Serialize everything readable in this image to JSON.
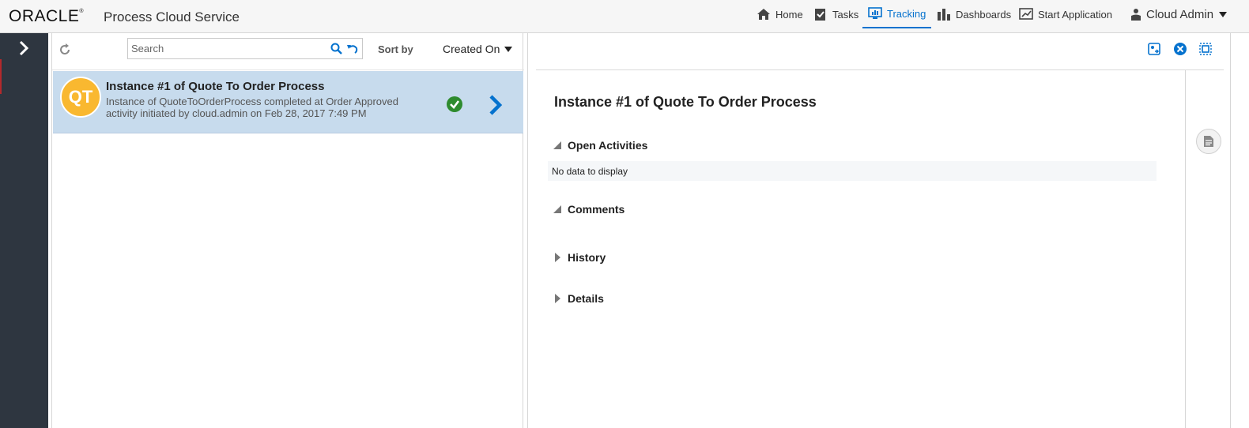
{
  "header": {
    "logo": "ORACLE",
    "app_title": "Process Cloud Service",
    "nav": [
      {
        "label": "Home",
        "icon": "home-icon"
      },
      {
        "label": "Tasks",
        "icon": "tasks-icon"
      },
      {
        "label": "Tracking",
        "icon": "tracking-icon",
        "active": true
      },
      {
        "label": "Dashboards",
        "icon": "dashboards-icon"
      },
      {
        "label": "Start Application",
        "icon": "start-application-icon"
      }
    ],
    "user": "Cloud Admin"
  },
  "list": {
    "search_placeholder": "Search",
    "sort_label": "Sort by",
    "sort_value": "Created On",
    "items": [
      {
        "avatar": "QT",
        "title": "Instance #1 of Quote To Order Process",
        "description": "Instance of QuoteToOrderProcess completed at Order Approved activity initiated by cloud.admin on Feb 28, 2017 7:49 PM",
        "status": "completed"
      }
    ]
  },
  "detail": {
    "title": "Instance #1 of Quote To Order Process",
    "sections": [
      {
        "label": "Open Activities",
        "expanded": true,
        "content": "No data to display"
      },
      {
        "label": "Comments",
        "expanded": true
      },
      {
        "label": "History",
        "expanded": false
      },
      {
        "label": "Details",
        "expanded": false
      }
    ]
  },
  "colors": {
    "accent": "#0572ce",
    "selected_row": "#c7dbed",
    "avatar": "#f9b830",
    "success": "#2e8b2e",
    "rail": "#2e3640"
  }
}
